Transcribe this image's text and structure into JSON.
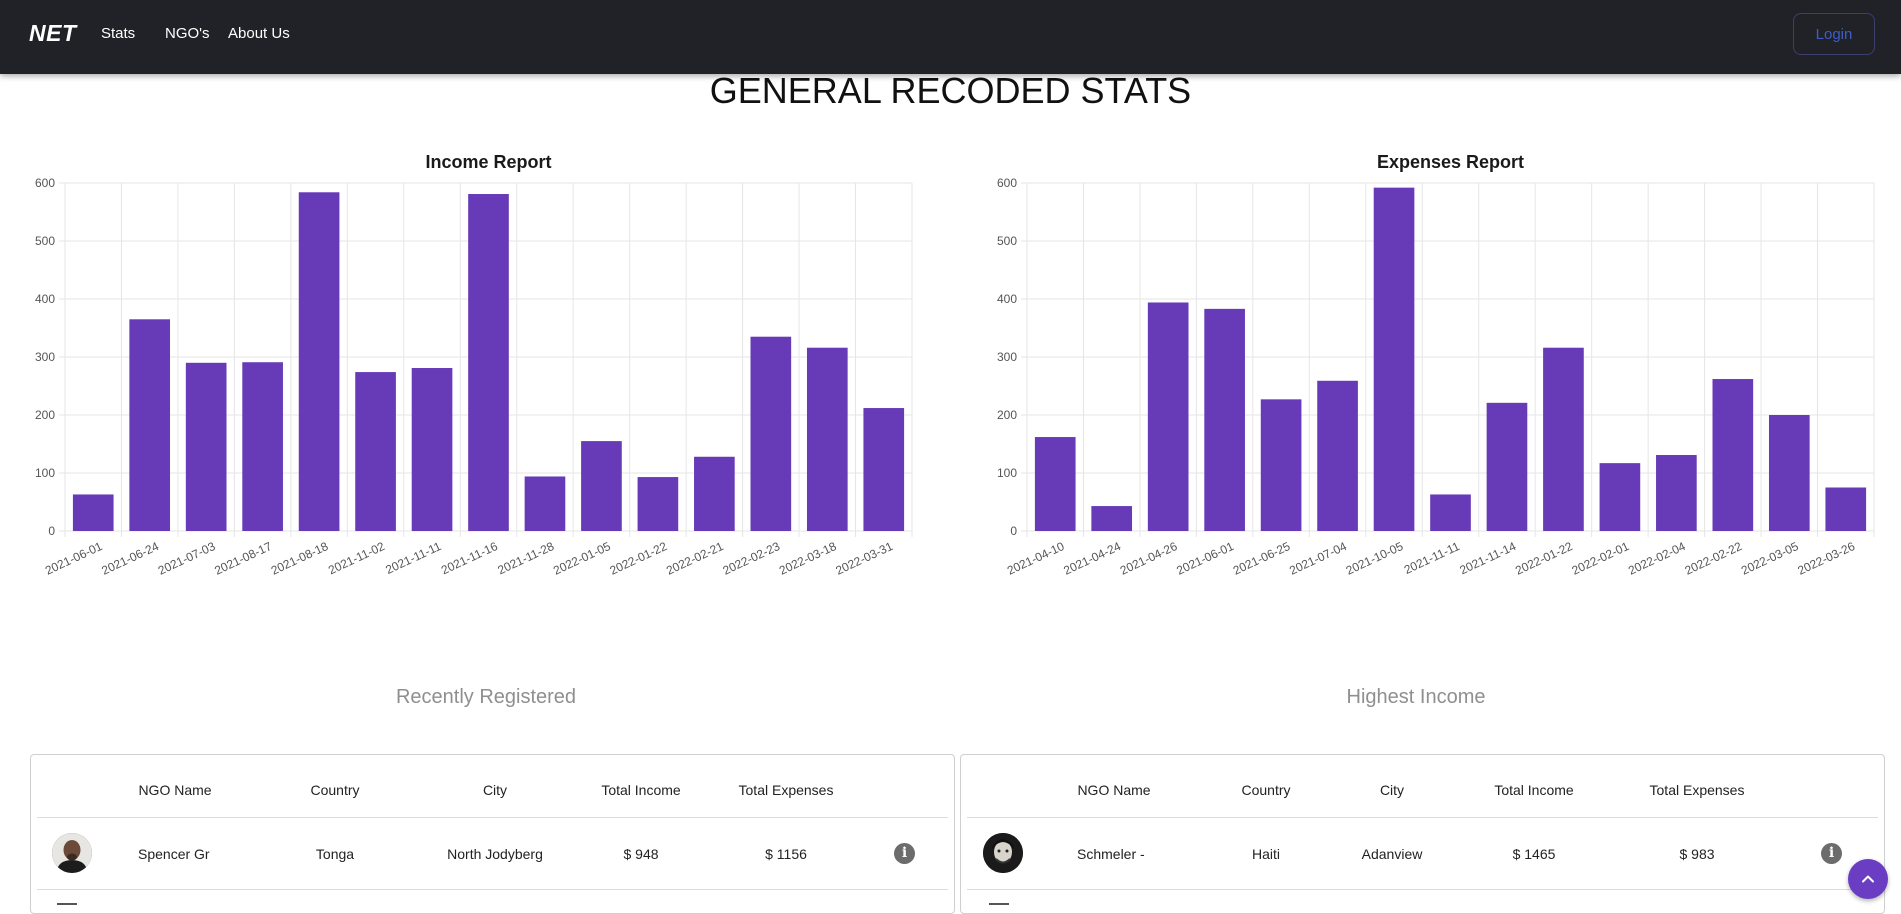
{
  "navbar": {
    "brand": "NET",
    "links": [
      "Stats",
      "NGO's",
      "About Us"
    ],
    "login": "Login"
  },
  "page_title": "GENERAL RECODED STATS",
  "chart_data": [
    {
      "type": "bar",
      "title": "Income Report",
      "xlabel": "",
      "ylabel": "",
      "ylim": [
        0,
        600
      ],
      "yticks": [
        0,
        100,
        200,
        300,
        400,
        500,
        600
      ],
      "grid": true,
      "color": "#673ab7",
      "categories": [
        "2021-06-01",
        "2021-06-24",
        "2021-07-03",
        "2021-08-17",
        "2021-08-18",
        "2021-11-02",
        "2021-11-11",
        "2021-11-16",
        "2021-11-28",
        "2022-01-05",
        "2022-01-22",
        "2022-02-21",
        "2022-02-23",
        "2022-03-18",
        "2022-03-31"
      ],
      "values": [
        63,
        365,
        290,
        291,
        584,
        274,
        281,
        581,
        94,
        155,
        93,
        128,
        335,
        316,
        212
      ]
    },
    {
      "type": "bar",
      "title": "Expenses Report",
      "xlabel": "",
      "ylabel": "",
      "ylim": [
        0,
        600
      ],
      "yticks": [
        0,
        100,
        200,
        300,
        400,
        500,
        600
      ],
      "grid": true,
      "color": "#673ab7",
      "categories": [
        "2021-04-10",
        "2021-04-24",
        "2021-04-26",
        "2021-06-01",
        "2021-06-25",
        "2021-07-04",
        "2021-10-05",
        "2021-11-11",
        "2021-11-14",
        "2022-01-22",
        "2022-02-01",
        "2022-02-04",
        "2022-02-22",
        "2022-03-05",
        "2022-03-26"
      ],
      "values": [
        162,
        43,
        394,
        383,
        227,
        259,
        592,
        63,
        221,
        316,
        117,
        131,
        262,
        200,
        75
      ]
    }
  ],
  "recent": {
    "title": "Recently Registered",
    "headers": [
      "NGO Name",
      "Country",
      "City",
      "Total Income",
      "Total Expenses"
    ],
    "row": {
      "name": "Spencer Gr",
      "country": "Tonga",
      "city": "North Jodyberg",
      "income": "$ 948",
      "expenses": "$ 1156"
    }
  },
  "highest": {
    "title": "Highest Income",
    "headers": [
      "NGO Name",
      "Country",
      "City",
      "Total Income",
      "Total Expenses"
    ],
    "row": {
      "name": "Schmeler -",
      "country": "Haiti",
      "city": "Adanview",
      "income": "$ 1465",
      "expenses": "$ 983"
    }
  },
  "icons": {
    "info": "info-icon",
    "scroll_top": "chevron-up-icon"
  }
}
